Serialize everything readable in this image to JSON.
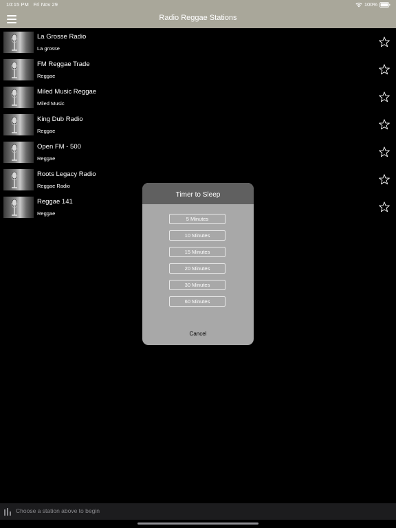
{
  "status_bar": {
    "time": "10:15 PM",
    "date": "Fri Nov 29",
    "battery": "100%"
  },
  "nav": {
    "title": "Radio Reggae Stations"
  },
  "stations": [
    {
      "name": "La Grosse Radio",
      "genre": "La grosse"
    },
    {
      "name": "FM Reggae Trade",
      "genre": "Reggae"
    },
    {
      "name": "Miled Music Reggae",
      "genre": "Miled Music"
    },
    {
      "name": "King Dub Radio",
      "genre": "Reggae"
    },
    {
      "name": "Open FM - 500",
      "genre": "Reggae"
    },
    {
      "name": "Roots Legacy Radio",
      "genre": "Reggae Radio"
    },
    {
      "name": "Reggae 141",
      "genre": "Reggae"
    }
  ],
  "sleep_timer": {
    "title": "Timer to Sleep",
    "options": [
      "5 Minutes",
      "10 Minutes",
      "15 Minutes",
      "20 Minutes",
      "30 Minutes",
      "60 Minutes"
    ],
    "cancel_label": "Cancel"
  },
  "player": {
    "prompt": "Choose a station above to begin"
  },
  "colors": {
    "nav_background": "#a9a79a",
    "modal_header": "#606060",
    "modal_body": "#a8a8a8",
    "player_background": "#1c1c1e"
  },
  "icons": {
    "menu": "hamburger-icon",
    "favorite": "star-outline-icon",
    "player": "equalizer-icon",
    "wifi": "wifi-icon",
    "battery": "battery-icon",
    "station_thumb": "microphone-icon"
  }
}
